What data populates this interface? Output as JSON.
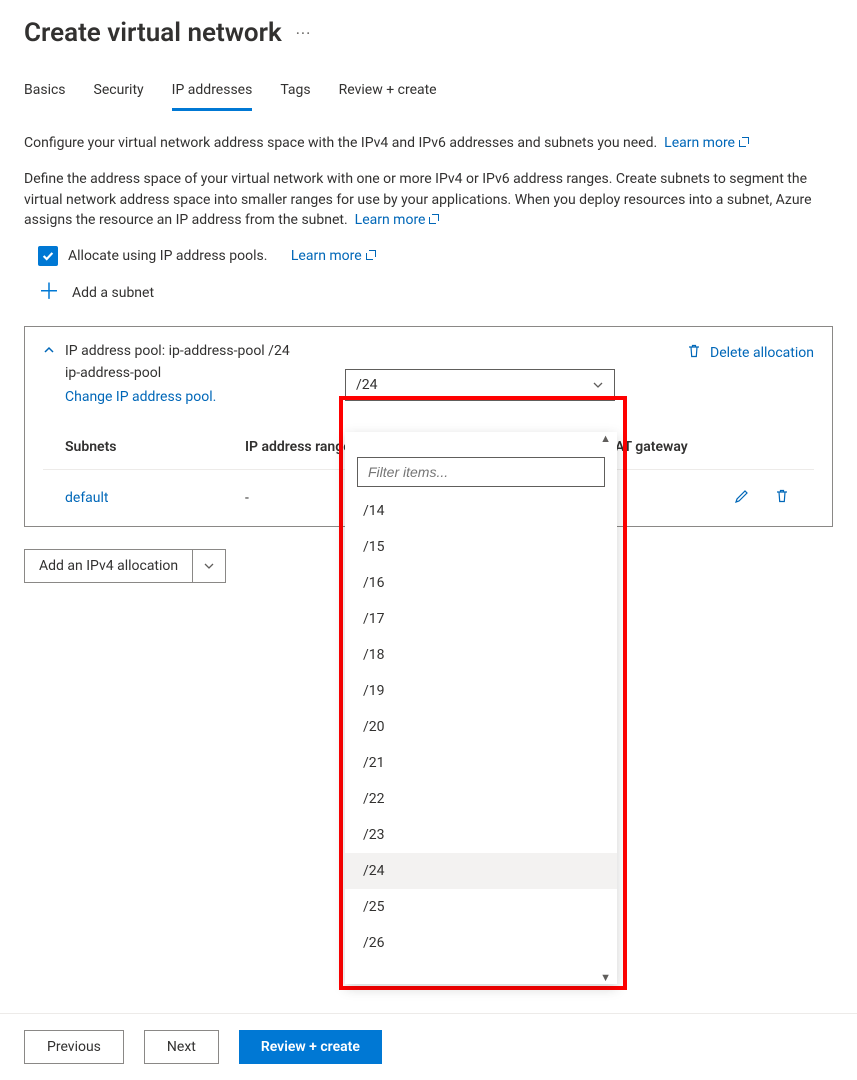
{
  "header": {
    "title": "Create virtual network"
  },
  "tabs": [
    {
      "label": "Basics",
      "active": false
    },
    {
      "label": "Security",
      "active": false
    },
    {
      "label": "IP addresses",
      "active": true
    },
    {
      "label": "Tags",
      "active": false
    },
    {
      "label": "Review + create",
      "active": false
    }
  ],
  "intro1_text": "Configure your virtual network address space with the IPv4 and IPv6 addresses and subnets you need.",
  "intro1_link": "Learn more",
  "intro2_text": "Define the address space of your virtual network with one or more IPv4 or IPv6 address ranges. Create subnets to segment the virtual network address space into smaller ranges for use by your applications. When you deploy resources into a subnet, Azure assigns the resource an IP address from the subnet.",
  "intro2_link": "Learn more",
  "allocate_checkbox_label": "Allocate using IP address pools.",
  "allocate_link": "Learn more",
  "add_subnet_label": "Add a subnet",
  "panel": {
    "title": "IP address pool: ip-address-pool /24",
    "pool_name": "ip-address-pool",
    "change_link": "Change IP address pool.",
    "prefix_selected": "/24",
    "delete_label": "Delete allocation",
    "columns": {
      "subnets": "Subnets",
      "ip_range": "IP address range",
      "nat": "NAT gateway"
    },
    "row": {
      "name": "default",
      "ip": "-"
    }
  },
  "add_alloc_label": "Add an IPv4 allocation",
  "footer": {
    "prev": "Previous",
    "next": "Next",
    "review": "Review + create"
  },
  "dropdown": {
    "filter_placeholder": "Filter items...",
    "selected": "/24",
    "items": [
      "/14",
      "/15",
      "/16",
      "/17",
      "/18",
      "/19",
      "/20",
      "/21",
      "/22",
      "/23",
      "/24",
      "/25",
      "/26"
    ]
  }
}
